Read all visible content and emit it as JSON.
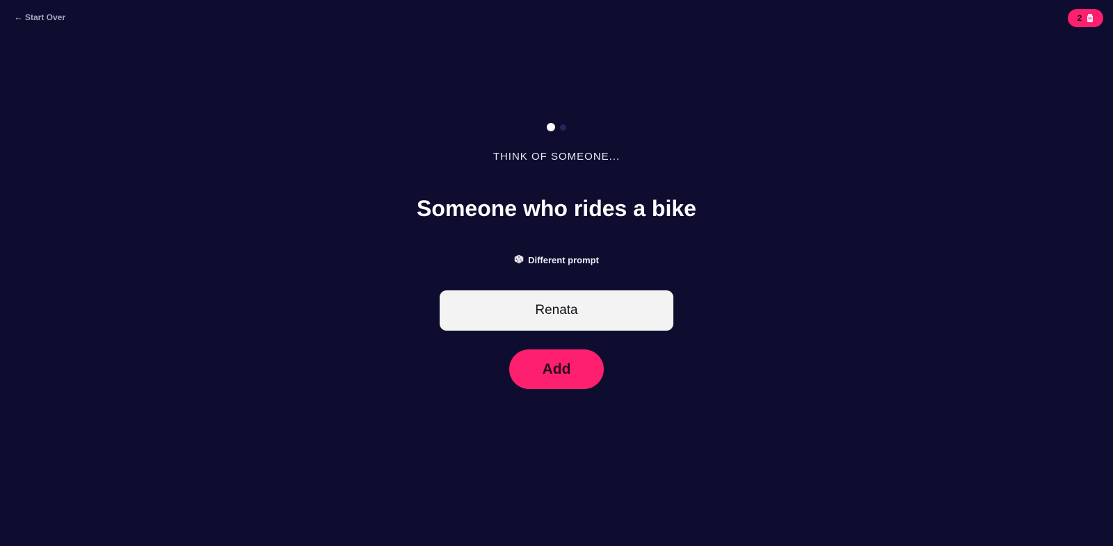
{
  "nav": {
    "start_over_arrow": "←",
    "start_over_label": "Start Over"
  },
  "badge": {
    "count": "2",
    "icon": "jar-icon"
  },
  "progress": {
    "current_step": 1,
    "total_steps": 2
  },
  "main": {
    "kicker": "THINK OF SOMEONE...",
    "prompt": "Someone who rides a bike",
    "different_prompt_icon": "dice-icon",
    "different_prompt_label": "Different prompt",
    "name_input_value": "Renata",
    "add_label": "Add"
  },
  "colors": {
    "background": "#0e0d2f",
    "accent": "#ff1f6f",
    "input_bg": "#f2f3f2",
    "dot_active": "#ffffff",
    "dot_inactive": "#25265a"
  }
}
